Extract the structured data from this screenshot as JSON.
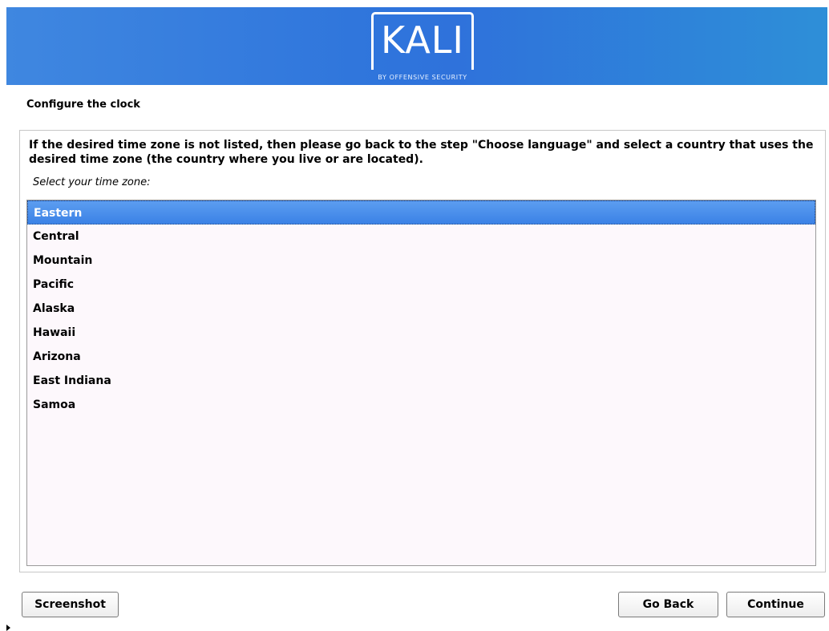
{
  "header": {
    "logo_text": "KALI",
    "logo_subtitle": "BY OFFENSIVE SECURITY"
  },
  "page_title": "Configure the clock",
  "description": "If the desired time zone is not listed, then please go back to the step \"Choose language\" and select a country that uses the desired time zone (the country where you live or are located).",
  "prompt": "Select your time zone:",
  "timezones": {
    "selected": "Eastern",
    "items": [
      "Eastern",
      "Central",
      "Mountain",
      "Pacific",
      "Alaska",
      "Hawaii",
      "Arizona",
      "East Indiana",
      "Samoa"
    ]
  },
  "buttons": {
    "screenshot": "Screenshot",
    "go_back": "Go Back",
    "continue": "Continue"
  },
  "colors": {
    "banner": "#2f75dc",
    "selection": "#3b82e6"
  }
}
